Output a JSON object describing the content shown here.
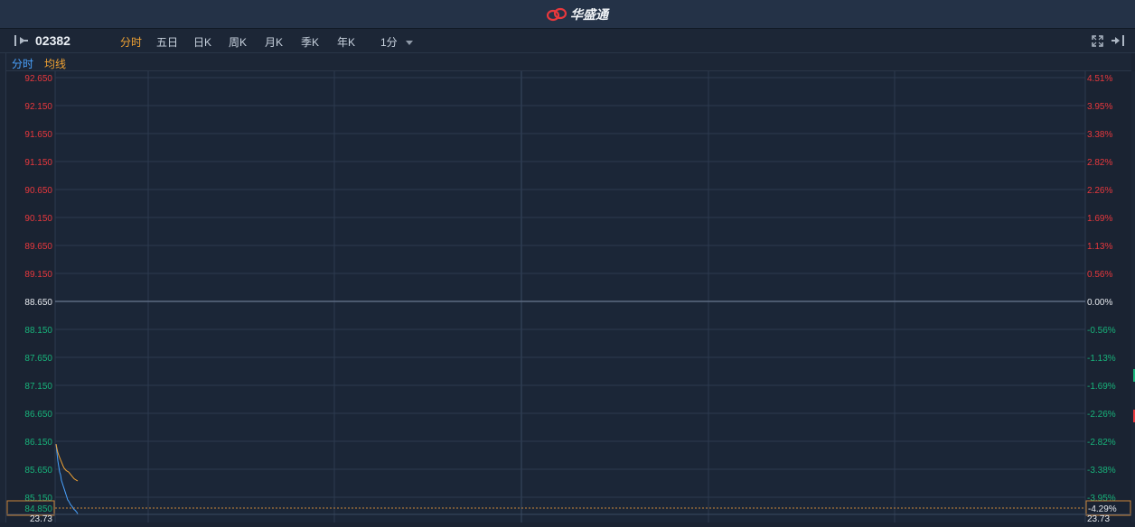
{
  "app": {
    "brand": "华盛通"
  },
  "toolbar": {
    "code": "02382",
    "tabs": [
      {
        "label": "分时",
        "active": true
      },
      {
        "label": "五日",
        "active": false
      },
      {
        "label": "日K",
        "active": false
      },
      {
        "label": "周K",
        "active": false
      },
      {
        "label": "月K",
        "active": false
      },
      {
        "label": "季K",
        "active": false
      },
      {
        "label": "年K",
        "active": false
      }
    ],
    "interval": "1分"
  },
  "subbar": {
    "series_label": "分时",
    "avg_label": "均线"
  },
  "colors": {
    "up": "#e8383d",
    "down": "#18b27a",
    "neutral": "#e6e9ee",
    "price_line": "#4aa3ff",
    "avg_line": "#f0a233",
    "grid": "#2c3a4f"
  },
  "chart_data": {
    "type": "line",
    "prev_close": 88.65,
    "ylim": [
      84.85,
      92.65
    ],
    "left_ticks": [
      "92.650",
      "92.150",
      "91.650",
      "91.150",
      "90.650",
      "90.150",
      "89.650",
      "89.150",
      "88.650",
      "88.150",
      "87.650",
      "87.150",
      "86.650",
      "86.150",
      "85.650",
      "85.150"
    ],
    "right_ticks": [
      "4.51%",
      "3.95%",
      "3.38%",
      "2.82%",
      "2.26%",
      "1.69%",
      "1.13%",
      "0.56%",
      "0.00%",
      "-0.56%",
      "-1.13%",
      "-1.69%",
      "-2.26%",
      "-2.82%",
      "-3.38%",
      "-3.95%"
    ],
    "current_price_label": "84.850",
    "current_pct_label": "-4.29%",
    "volume_label_left": "23.73",
    "volume_label_right": "23.73",
    "series": [
      {
        "name": "分时",
        "x": [
          0,
          1,
          2,
          3,
          4,
          5,
          6,
          7,
          8,
          9,
          10,
          11,
          12,
          13,
          14,
          15,
          16,
          17,
          18,
          19,
          20,
          21,
          22,
          23,
          24
        ],
        "values": [
          86.1,
          85.95,
          85.8,
          85.7,
          85.6,
          85.55,
          85.45,
          85.4,
          85.35,
          85.3,
          85.25,
          85.2,
          85.15,
          85.1,
          85.08,
          85.05,
          85.02,
          85.0,
          84.98,
          84.95,
          84.93,
          84.92,
          84.9,
          84.88,
          84.85
        ]
      },
      {
        "name": "均线",
        "x": [
          0,
          1,
          2,
          3,
          4,
          5,
          6,
          7,
          8,
          9,
          10,
          11,
          12,
          13,
          14,
          15,
          16,
          17,
          18,
          19,
          20,
          21,
          22,
          23,
          24
        ],
        "values": [
          86.1,
          86.02,
          85.95,
          85.9,
          85.86,
          85.82,
          85.78,
          85.74,
          85.7,
          85.67,
          85.65,
          85.63,
          85.62,
          85.61,
          85.6,
          85.58,
          85.56,
          85.54,
          85.52,
          85.5,
          85.48,
          85.47,
          85.46,
          85.45,
          85.44
        ]
      }
    ]
  }
}
